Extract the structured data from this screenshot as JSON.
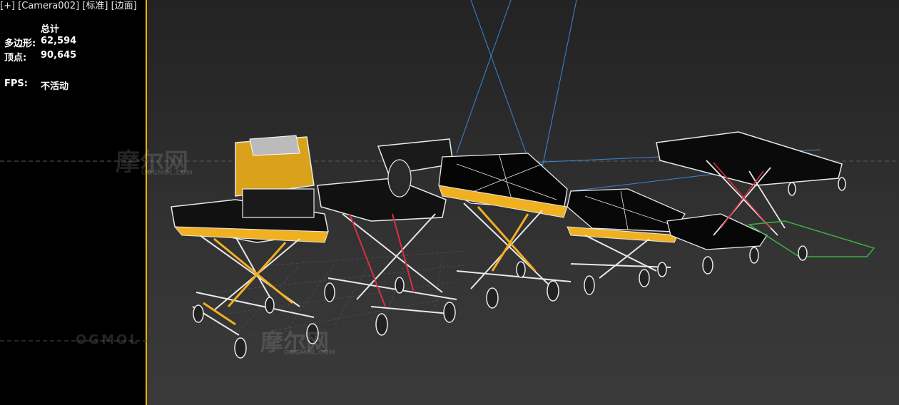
{
  "viewport_menu": {
    "plus": "[+]",
    "camera": "[Camera002]",
    "shading_standard": "[标准]",
    "edged_faces": "[边面]"
  },
  "stats": {
    "header": "总计",
    "polygons_label": "多边形:",
    "polygons_value": "62,594",
    "vertices_label": "顶点:",
    "vertices_value": "90,645",
    "fps_label": "FPS:",
    "fps_value": "不活动"
  },
  "watermarks": {
    "logo_text": "摩尔网",
    "logo_sub": "OOGMOL.COM",
    "brand": "OGMOL"
  },
  "colors": {
    "active_viewport_border": "#f0b400",
    "wire_white": "#e8e8e8",
    "wire_yellow": "#f0b020",
    "wire_red": "#d83040",
    "wire_green": "#3cb043",
    "camera_lines": "#3a86d8"
  }
}
